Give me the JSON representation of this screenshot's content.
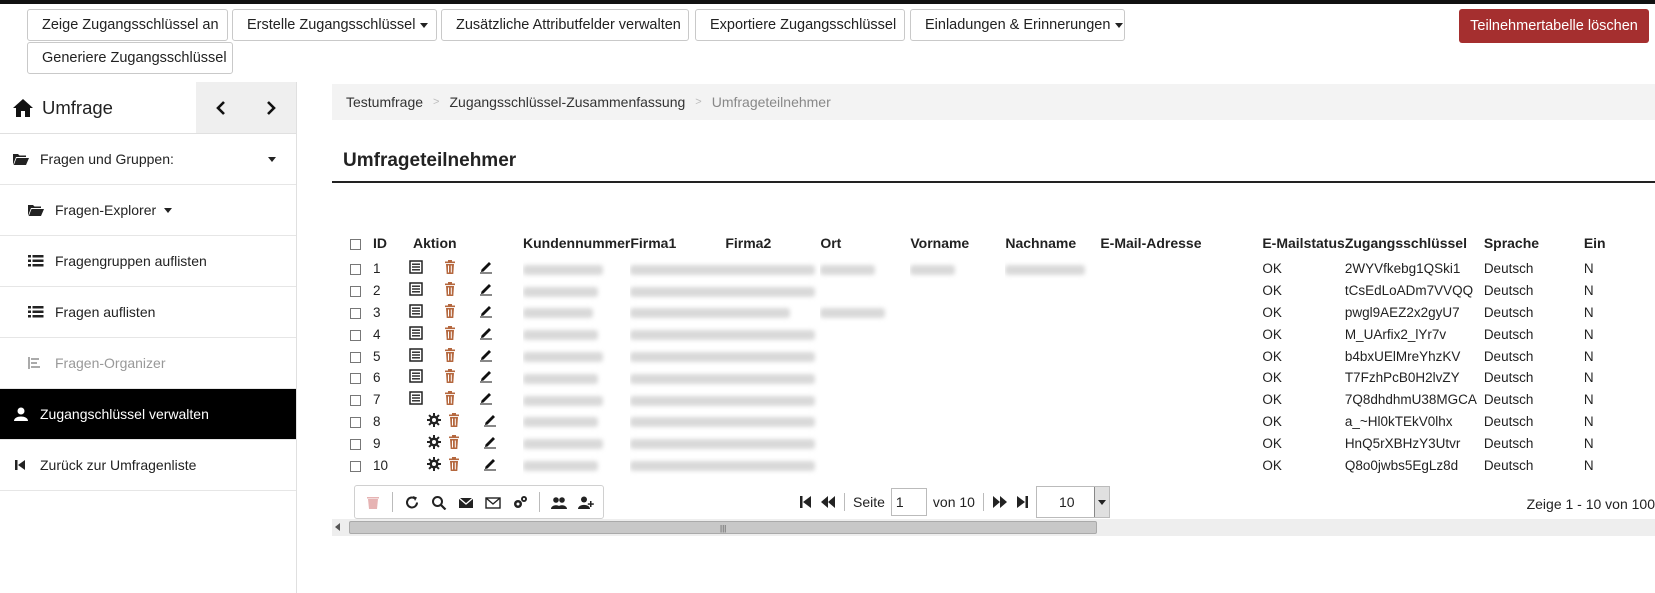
{
  "toolbar": {
    "show_tokens": "Zeige Zugangsschlüssel an",
    "create_tokens": "Erstelle Zugangsschlüssel",
    "manage_attributes": "Zusätzliche Attributfelder verwalten",
    "export_tokens": "Exportiere Zugangsschlüssel",
    "invitations": "Einladungen & Erinnerungen",
    "generate_tokens": "Generiere Zugangsschlüssel",
    "delete_table": "Teilnehmertabelle löschen"
  },
  "sidebar": {
    "title": "Umfrage",
    "items": [
      {
        "label": "Fragen und Gruppen:"
      },
      {
        "label": "Fragen-Explorer"
      },
      {
        "label": "Fragengruppen auflisten"
      },
      {
        "label": "Fragen auflisten"
      },
      {
        "label": "Fragen-Organizer"
      },
      {
        "label": "Zugangschlüssel verwalten"
      },
      {
        "label": "Zurück zur Umfragenliste"
      }
    ]
  },
  "breadcrumb": {
    "items": [
      "Testumfrage",
      "Zugangsschlüssel-Zusammenfassung",
      "Umfrageteilnehmer"
    ],
    "separator": ">"
  },
  "page": {
    "title": "Umfrageteilnehmer"
  },
  "table": {
    "headers": {
      "id": "ID",
      "action": "Aktion",
      "kundennummer": "Kundennummer",
      "firma1": "Firma1",
      "firma2": "Firma2",
      "ort": "Ort",
      "vorname": "Vorname",
      "nachname": "Nachname",
      "email": "E-Mail-Adresse",
      "emailstatus": "E-Mailstatus",
      "token": "Zugangsschlüssel",
      "sprache": "Sprache",
      "ein": "Ein"
    },
    "rows": [
      {
        "id": "1",
        "emailstatus": "OK",
        "token": "2WYVfkebg1QSki1",
        "sprache": "Deutsch",
        "ein": "N"
      },
      {
        "id": "2",
        "emailstatus": "OK",
        "token": "tCsEdLoADm7VVQQ",
        "sprache": "Deutsch",
        "ein": "N"
      },
      {
        "id": "3",
        "emailstatus": "OK",
        "token": "pwgl9AEZ2x2gyU7",
        "sprache": "Deutsch",
        "ein": "N"
      },
      {
        "id": "4",
        "emailstatus": "OK",
        "token": "M_UArfix2_lYr7v",
        "sprache": "Deutsch",
        "ein": "N"
      },
      {
        "id": "5",
        "emailstatus": "OK",
        "token": "b4bxUElMreYhzKV",
        "sprache": "Deutsch",
        "ein": "N"
      },
      {
        "id": "6",
        "emailstatus": "OK",
        "token": "T7FzhPcB0H2lvZY",
        "sprache": "Deutsch",
        "ein": "N"
      },
      {
        "id": "7",
        "emailstatus": "OK",
        "token": "7Q8dhdhmU38MGCA",
        "sprache": "Deutsch",
        "ein": "N"
      },
      {
        "id": "8",
        "emailstatus": "OK",
        "token": "a_~Hl0kTEkV0lhx",
        "sprache": "Deutsch",
        "ein": "N"
      },
      {
        "id": "9",
        "emailstatus": "OK",
        "token": "HnQ5rXBHzY3Utvr",
        "sprache": "Deutsch",
        "ein": "N"
      },
      {
        "id": "10",
        "emailstatus": "OK",
        "token": "Q8o0jwbs5EgLz8d",
        "sprache": "Deutsch",
        "ein": "N"
      }
    ]
  },
  "pager": {
    "page_label": "Seite",
    "page_value": "1",
    "of_label": "von 10",
    "page_size": "10",
    "info": "Zeige 1 - 10 von 100"
  },
  "colors": {
    "danger": "#a52f2f",
    "delete_icon": "#b5683f",
    "active_bg": "#000000"
  }
}
